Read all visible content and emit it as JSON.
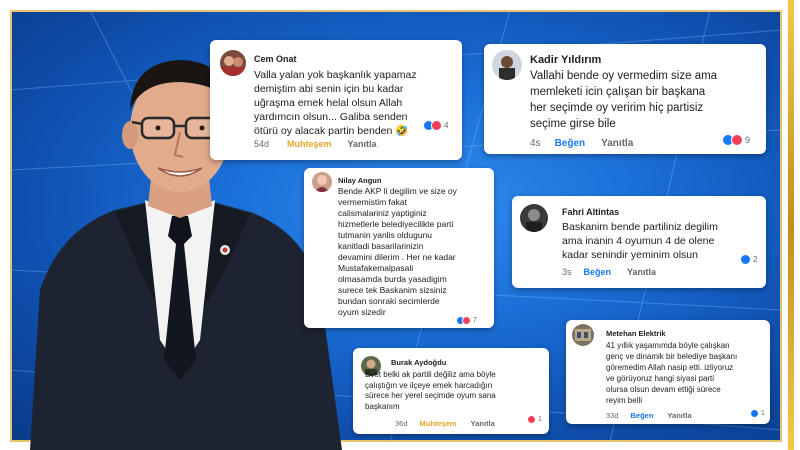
{
  "comments": [
    {
      "author": "Cem Onat",
      "text": "Valla yalan yok başkanlık yapamaz\ndemiştim abi senin için bu kadar\nuğraşma emek helal olsun Allah\nyardımcın olsun... Galiba senden\nötürü oy alacak partin benden 🤣",
      "time": "54d",
      "reaction_label": "Muhteşem",
      "reply": "Yanıtla",
      "reaction_count": "4"
    },
    {
      "author": "Kadir Yıldırım",
      "text": "Vallahi bende oy vermedim size ama\nmemleketi icin çalışan bir başkana\nher seçimde oy veririm hiç partisiz\nseçime  girse  bile",
      "time": "4s",
      "reaction_label": "Beğen",
      "reply": "Yanıtla",
      "reaction_count": "9"
    },
    {
      "author": "Nilay Angun",
      "text": "Bende AKP li degilim ve size oy\nvermemistim fakat\ncalismalariniz yaptiginiz\nhizmetlerle belediyecilikte parti\ntutmanin yanlis oldugunu\nkanitladi  basarilarinizin\ndevamini dilerim . Her ne kadar\nMustafakemalpasali\nolmasamda burda yasadigim\nsurece tek Baskanim sizsiniz\nbundan sonraki secimlerde\noyum sizedir",
      "reaction_count": "7"
    },
    {
      "author": "Fahri Altintas",
      "text": "Baskanim bende partiliniz degilim\nama inanin 4 oyumun 4 de olene\nkadar senindir yeminim olsun",
      "time": "3s",
      "reaction_label": "Beğen",
      "reply": "Yanıtla",
      "reaction_count": "2"
    },
    {
      "author": "Burak Aydoğdu",
      "text": "Evet belki ak partili değiliz ama böyle\nçalıştığın ve ilçeye emek harcadığın\nsürece her yerel seçimde oyum sana\nbaşkanım",
      "time": "36d",
      "reaction_label": "Muhteşem",
      "reply": "Yanıtla",
      "reaction_count": "1"
    },
    {
      "author": "Metehan Elektrik",
      "text": "41 yıllık yaşamımda böyle çalışkan\ngenç ve dinamik bir belediye başkanı\ngöremedim Allah nasip etti. izliyoruz\nve görüyoruz hangi siyasi parti\nolursa olsun devam ettiği sürece\nreyim belli",
      "time": "33d",
      "reaction_label": "Beğen",
      "reply": "Yanıtla",
      "reaction_count": "1"
    }
  ],
  "colors": {
    "background": "#1a6fd8",
    "frame": "#e9c36a",
    "muhtesem": "#e4a62a",
    "begen": "#1877f2",
    "like": "#1877f2",
    "love": "#f33e58"
  }
}
